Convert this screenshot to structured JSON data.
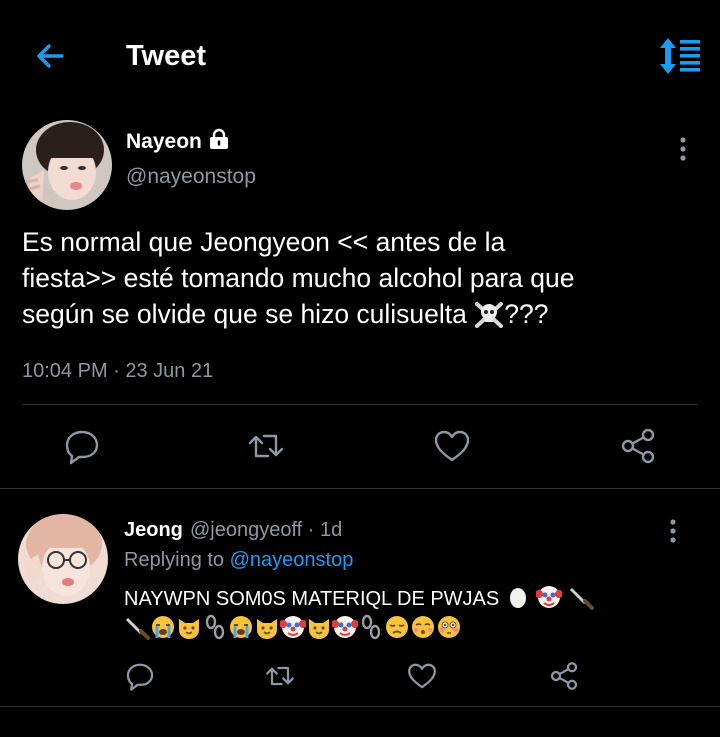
{
  "header": {
    "title": "Tweet",
    "back_icon": "arrow-left-icon",
    "sort_icon": "sort-icon",
    "accent": "#1d9bf0"
  },
  "main_tweet": {
    "display_name": "Nayeon",
    "handle": "@nayeonstop",
    "protected_icon": "lock-icon",
    "text_lines": [
      "Es normal que Jeongyeon << antes de la",
      "fiesta>> esté tomando mucho alcohol para que",
      "según se olvide que se hizo culisuelta "
    ],
    "text_suffix": "???",
    "skull_emoji": "skull-crossbones-icon",
    "timestamp": "10:04 PM · 23 Jun 21"
  },
  "actions": [
    "reply-icon",
    "retweet-icon",
    "like-icon",
    "share-icon"
  ],
  "reply": {
    "display_name": "Jeong",
    "handle_time": "@jeongyeoff · 1d",
    "replying_label": "Replying to ",
    "replying_to": "@nayeonstop",
    "text": "NAYWPN SOM0S MATERIQL DE PWJAS",
    "emoji_line1": [
      "egg-emoji",
      "clown-emoji",
      "knife-emoji"
    ],
    "emoji_line2": [
      "knife-emoji",
      "crying-emoji",
      "cat-emoji",
      "chains-emoji",
      "crying-emoji",
      "cat-emoji",
      "clown-emoji",
      "cat-emoji",
      "clown-emoji",
      "chains-emoji",
      "disappointed-emoji",
      "kissing-emoji",
      "flushed-emoji"
    ]
  },
  "colors": {
    "background": "#000000",
    "text": "#ffffff",
    "secondary": "#8b98a5",
    "divider": "#2f3336",
    "link": "#1d9bf0"
  }
}
